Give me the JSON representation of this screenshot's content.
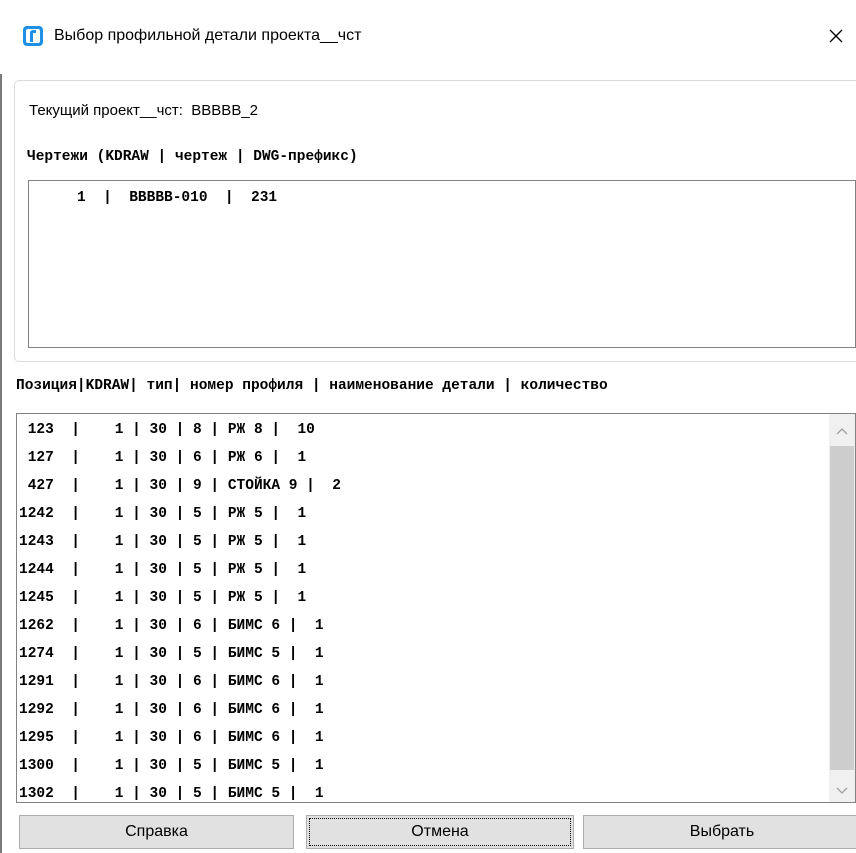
{
  "window": {
    "title": "Выбор профильной детали проекта__чст",
    "icon": "app-window-icon",
    "close_icon": "close-icon"
  },
  "project": {
    "label": "Текущий проект__чст:",
    "value": "BBBBB_2"
  },
  "drawings": {
    "header": "Чертежи (KDRAW | чертеж | DWG-префикс)",
    "items": [
      "1  |  BBBBB-010  |  231"
    ]
  },
  "parts": {
    "header": "Позиция|KDRAW| тип| номер профиля | наименование детали | количество",
    "items": [
      " 123  |    1 | 30 | 8 | РЖ 8 |  10",
      " 127  |    1 | 30 | 6 | РЖ 6 |  1",
      " 427  |    1 | 30 | 9 | СТОЙКА 9 |  2",
      "1242  |    1 | 30 | 5 | РЖ 5 |  1",
      "1243  |    1 | 30 | 5 | РЖ 5 |  1",
      "1244  |    1 | 30 | 5 | РЖ 5 |  1",
      "1245  |    1 | 30 | 5 | РЖ 5 |  1",
      "1262  |    1 | 30 | 6 | БИМС 6 |  1",
      "1274  |    1 | 30 | 5 | БИМС 5 |  1",
      "1291  |    1 | 30 | 6 | БИМС 6 |  1",
      "1292  |    1 | 30 | 6 | БИМС 6 |  1",
      "1295  |    1 | 30 | 6 | БИМС 6 |  1",
      "1300  |    1 | 30 | 5 | БИМС 5 |  1",
      "1302  |    1 | 30 | 5 | БИМС 5 |  1"
    ]
  },
  "buttons": {
    "help": "Справка",
    "cancel": "Отмена",
    "select": "Выбрать"
  },
  "colors": {
    "icon_blue": "#1e90e6",
    "button_face": "#e1e1e1",
    "scroll_thumb": "#cdcdcd"
  }
}
